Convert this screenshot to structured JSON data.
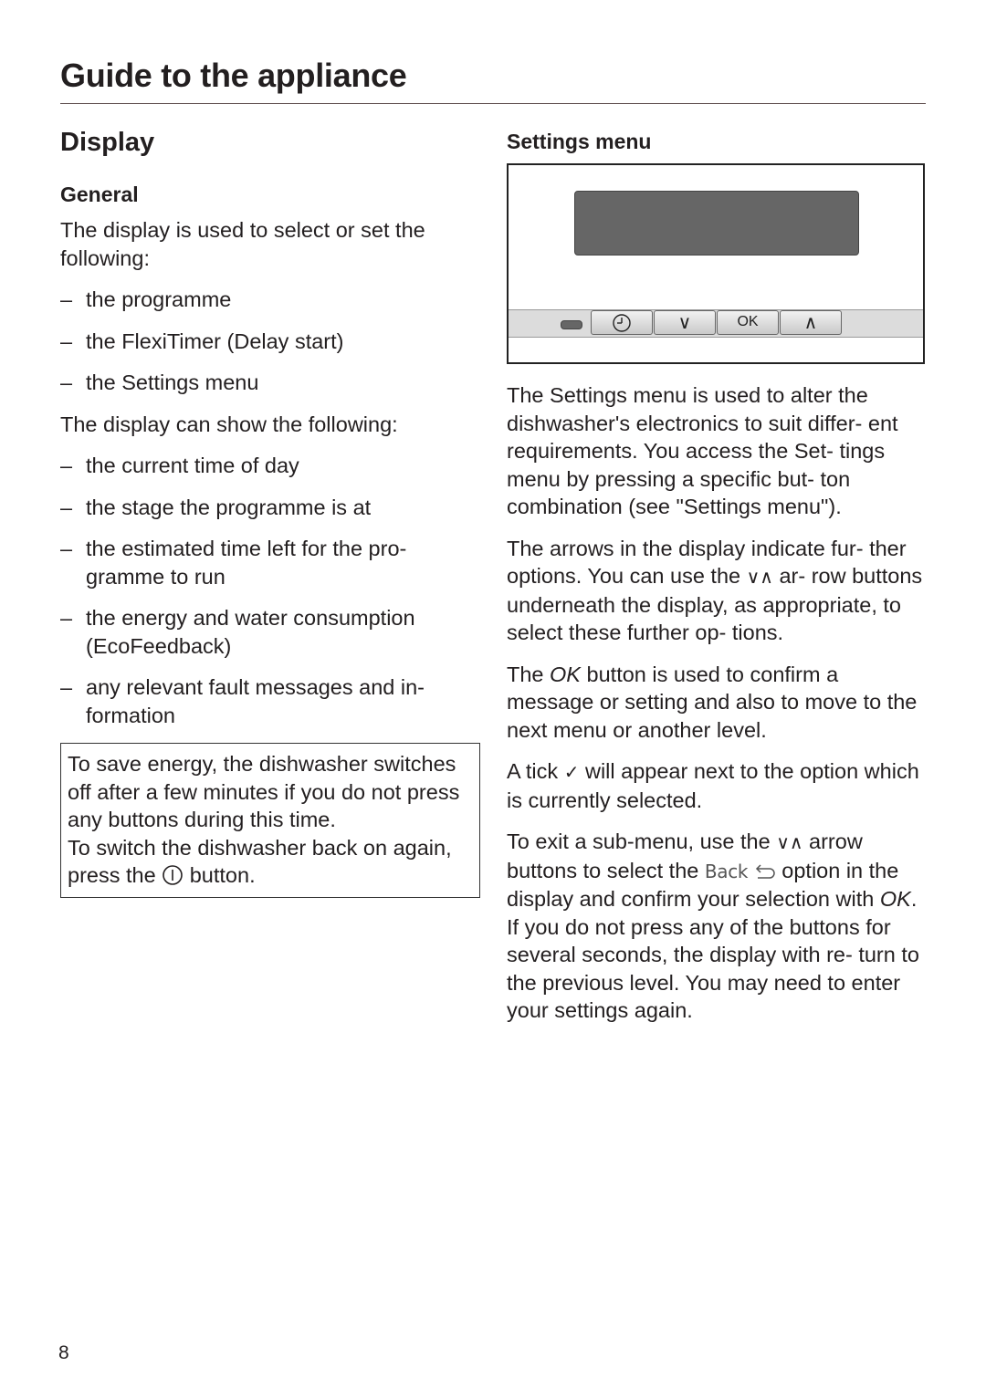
{
  "header": {
    "title": "Guide to the appliance"
  },
  "section": {
    "title": "Display"
  },
  "general": {
    "heading": "General",
    "intro": "The display is used to select or set the following:",
    "select_items": [
      "the programme",
      "the FlexiTimer (Delay start)",
      "the Settings menu"
    ],
    "show_intro": "The display can show the following:",
    "show_items": [
      "the current time of day",
      "the stage the programme is at",
      "the estimated time left for the pro- gramme to run",
      "the energy and water consumption (EcoFeedback)",
      "any relevant fault messages and in- formation"
    ],
    "note": {
      "line1": "To save energy, the dishwasher switches off after a few minutes if you do not press any buttons during this time.",
      "line2_before": "To switch the dishwasher back on again, press the ",
      "power_symbol": "①",
      "line2_after": " button."
    }
  },
  "settings": {
    "heading": "Settings menu",
    "panel": {
      "buttons": [
        {
          "name": "timer",
          "icon": "clock-icon",
          "label": ""
        },
        {
          "name": "down",
          "icon": "chevron-down-icon",
          "label": "∨"
        },
        {
          "name": "ok",
          "icon": "",
          "label": "OK"
        },
        {
          "name": "up",
          "icon": "chevron-up-icon",
          "label": "∧"
        }
      ]
    },
    "p1": "The Settings menu is used to alter the dishwasher's electronics to suit differ- ent requirements. You access the Set- tings menu by pressing a specific but- ton combination (see \"Settings menu\").",
    "p2_before": "The arrows in the display indicate fur- ther options. You can use the ",
    "arrows_symbol": "∨∧",
    "p2_after": " ar- row buttons underneath the display, as appropriate, to select these further op- tions.",
    "p3_ok": "OK",
    "p3_after": " button is used to confirm a message or setting and also to move to the next menu or another level.",
    "p3_before": "The ",
    "p4_before": "A tick ",
    "tick_symbol": "✓",
    "p4_after": " will appear next to the option which is currently selected.",
    "p5_a": "To exit a sub-menu, use the ",
    "p5_b": " arrow buttons to select the ",
    "back_word": "Back",
    "back_symbol": "⮌",
    "p5_c": " option in the display and confirm your selection with ",
    "p5_ok": "OK",
    "p5_end": ".",
    "p6": "If you do not press any of the buttons for several seconds, the display with re- turn to the previous level. You may need to enter your settings again."
  },
  "footer": {
    "page_number": "8"
  }
}
